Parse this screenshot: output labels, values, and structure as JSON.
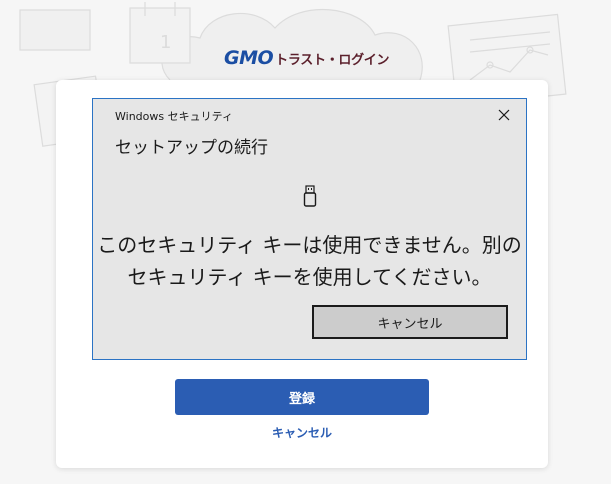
{
  "brand": {
    "logo": "GMO",
    "name": "トラスト・ログイン"
  },
  "dialog": {
    "window_title": "Windows セキュリティ",
    "heading": "セットアップの続行",
    "icon": "usb-key-icon",
    "message_line1": "このセキュリティ キーは使用できません。別の",
    "message_line2": "セキュリティ キーを使用してください。",
    "cancel_label": "キャンセル",
    "close_icon": "close-icon"
  },
  "page": {
    "register_label": "登録",
    "cancel_label": "キャンセル"
  },
  "colors": {
    "accent": "#2b5db3",
    "dialog_border": "#2b73c4",
    "dialog_bg": "#e6e6e6",
    "brand_blue": "#1b4ea3",
    "brand_dark": "#5b1f2b"
  }
}
